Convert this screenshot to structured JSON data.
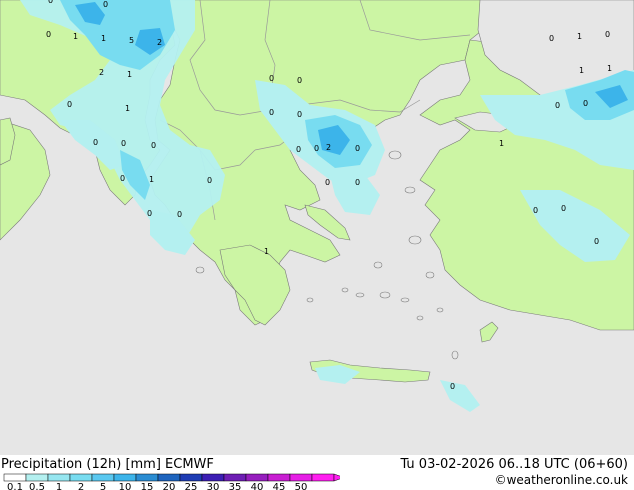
{
  "title_left": "Precipitation (12h) [mm] ECMWF",
  "title_right": "Tu 03-02-2026 06..18 UTC (06+60)",
  "credit": "©weatheronline.co.uk",
  "colors": {
    "sea": "#e6e6e6",
    "land": "#ccf5a4",
    "border": "#999999",
    "coast": "#7a7a7a",
    "precip_light": "#b4f0f0",
    "precip_mid": "#78dcf0",
    "precip_heavy": "#3cb4ea"
  },
  "legend": {
    "labels": [
      "0.1",
      "0.5",
      "1",
      "2",
      "5",
      "10",
      "15",
      "20",
      "25",
      "30",
      "35",
      "40",
      "45",
      "50"
    ],
    "colors": [
      "#ffffff",
      "#b4f0f0",
      "#96e6f0",
      "#78dcf0",
      "#5ac8f0",
      "#3cb4ea",
      "#2a8cd2",
      "#1e64be",
      "#1e3cb4",
      "#3c1eb4",
      "#6e1eb4",
      "#961ebe",
      "#c81ed2",
      "#e61ee6",
      "#ff1ef0"
    ]
  },
  "value_labels": [
    {
      "t": "0"
    },
    {
      "t": "0"
    },
    {
      "t": "0"
    },
    {
      "t": "1"
    },
    {
      "t": "1"
    },
    {
      "t": "5"
    },
    {
      "t": "2"
    },
    {
      "t": "2"
    },
    {
      "t": "1"
    },
    {
      "t": "1"
    },
    {
      "t": "0"
    },
    {
      "t": "0"
    },
    {
      "t": "0"
    },
    {
      "t": "0"
    },
    {
      "t": "0"
    },
    {
      "t": "0"
    },
    {
      "t": "0"
    },
    {
      "t": "0"
    },
    {
      "t": "0"
    },
    {
      "t": "0"
    },
    {
      "t": "1"
    },
    {
      "t": "0"
    },
    {
      "t": "0"
    },
    {
      "t": "0"
    },
    {
      "t": "0"
    },
    {
      "t": "2"
    },
    {
      "t": "0"
    },
    {
      "t": "0"
    },
    {
      "t": "0"
    },
    {
      "t": "1"
    },
    {
      "t": "0"
    },
    {
      "t": "1"
    },
    {
      "t": "0"
    },
    {
      "t": "1"
    },
    {
      "t": "1"
    },
    {
      "t": "0"
    },
    {
      "t": "0"
    },
    {
      "t": "1"
    },
    {
      "t": "0"
    },
    {
      "t": "0"
    },
    {
      "t": "0"
    }
  ]
}
